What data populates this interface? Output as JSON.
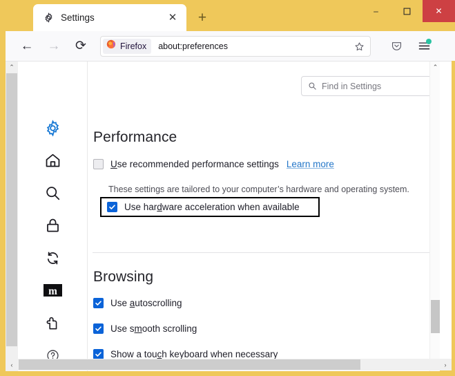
{
  "window": {
    "controls": {
      "minimize": "–",
      "maximize": "❑",
      "close": "✕"
    }
  },
  "tabbar": {
    "tab": {
      "title": "Settings",
      "favicon": "gear-icon",
      "close": "✕"
    },
    "new_tab": "+"
  },
  "navbar": {
    "back": "←",
    "forward": "→",
    "reload": "⟳",
    "identity_chip": "Firefox",
    "url": "about:preferences",
    "bookmark_star": "☆",
    "pocket": "pocket-icon",
    "menu": "hamburger-menu-icon"
  },
  "sidebar": {
    "items": [
      {
        "name": "general",
        "icon": "gear-icon",
        "selected": true
      },
      {
        "name": "home",
        "icon": "home-icon",
        "selected": false
      },
      {
        "name": "search",
        "icon": "search-icon",
        "selected": false
      },
      {
        "name": "privacy",
        "icon": "lock-icon",
        "selected": false
      },
      {
        "name": "sync",
        "icon": "sync-icon",
        "selected": false
      },
      {
        "name": "mozilla",
        "icon": "mozilla-m-icon",
        "selected": false
      },
      {
        "name": "extensions",
        "icon": "extension-icon",
        "selected": false
      },
      {
        "name": "support",
        "icon": "question-mark-icon",
        "selected": false
      }
    ]
  },
  "search": {
    "placeholder": "Find in Settings",
    "value": "",
    "icon": "search-icon"
  },
  "performance": {
    "heading": "Performance",
    "recommended": {
      "label_pre": "",
      "label_accesskey": "U",
      "label_post": "se recommended performance settings",
      "checked": false
    },
    "learn_more": "Learn more",
    "description": "These settings are tailored to your computer’s hardware and operating system.",
    "hardware_acceleration": {
      "label_pre": "Use har",
      "label_accesskey": "d",
      "label_post": "ware acceleration when available",
      "checked": true,
      "highlighted": true
    }
  },
  "browsing": {
    "heading": "Browsing",
    "options": [
      {
        "label_pre": "Use ",
        "label_accesskey": "a",
        "label_post": "utoscrolling",
        "checked": true
      },
      {
        "label_pre": "Use s",
        "label_accesskey": "m",
        "label_post": "ooth scrolling",
        "checked": true
      },
      {
        "label_pre": "Show a tou",
        "label_accesskey": "c",
        "label_post": "h keyboard when necessary",
        "checked": true
      }
    ]
  },
  "scrollbars": {
    "up": "⌃",
    "down": "⌄",
    "left": "‹",
    "right": "›"
  },
  "colors": {
    "titlebar": "#efc85a",
    "accent_blue": "#0a63d8",
    "link_blue": "#2376c8",
    "close_red": "#cd4043",
    "badge_green": "#2ac3a2"
  }
}
